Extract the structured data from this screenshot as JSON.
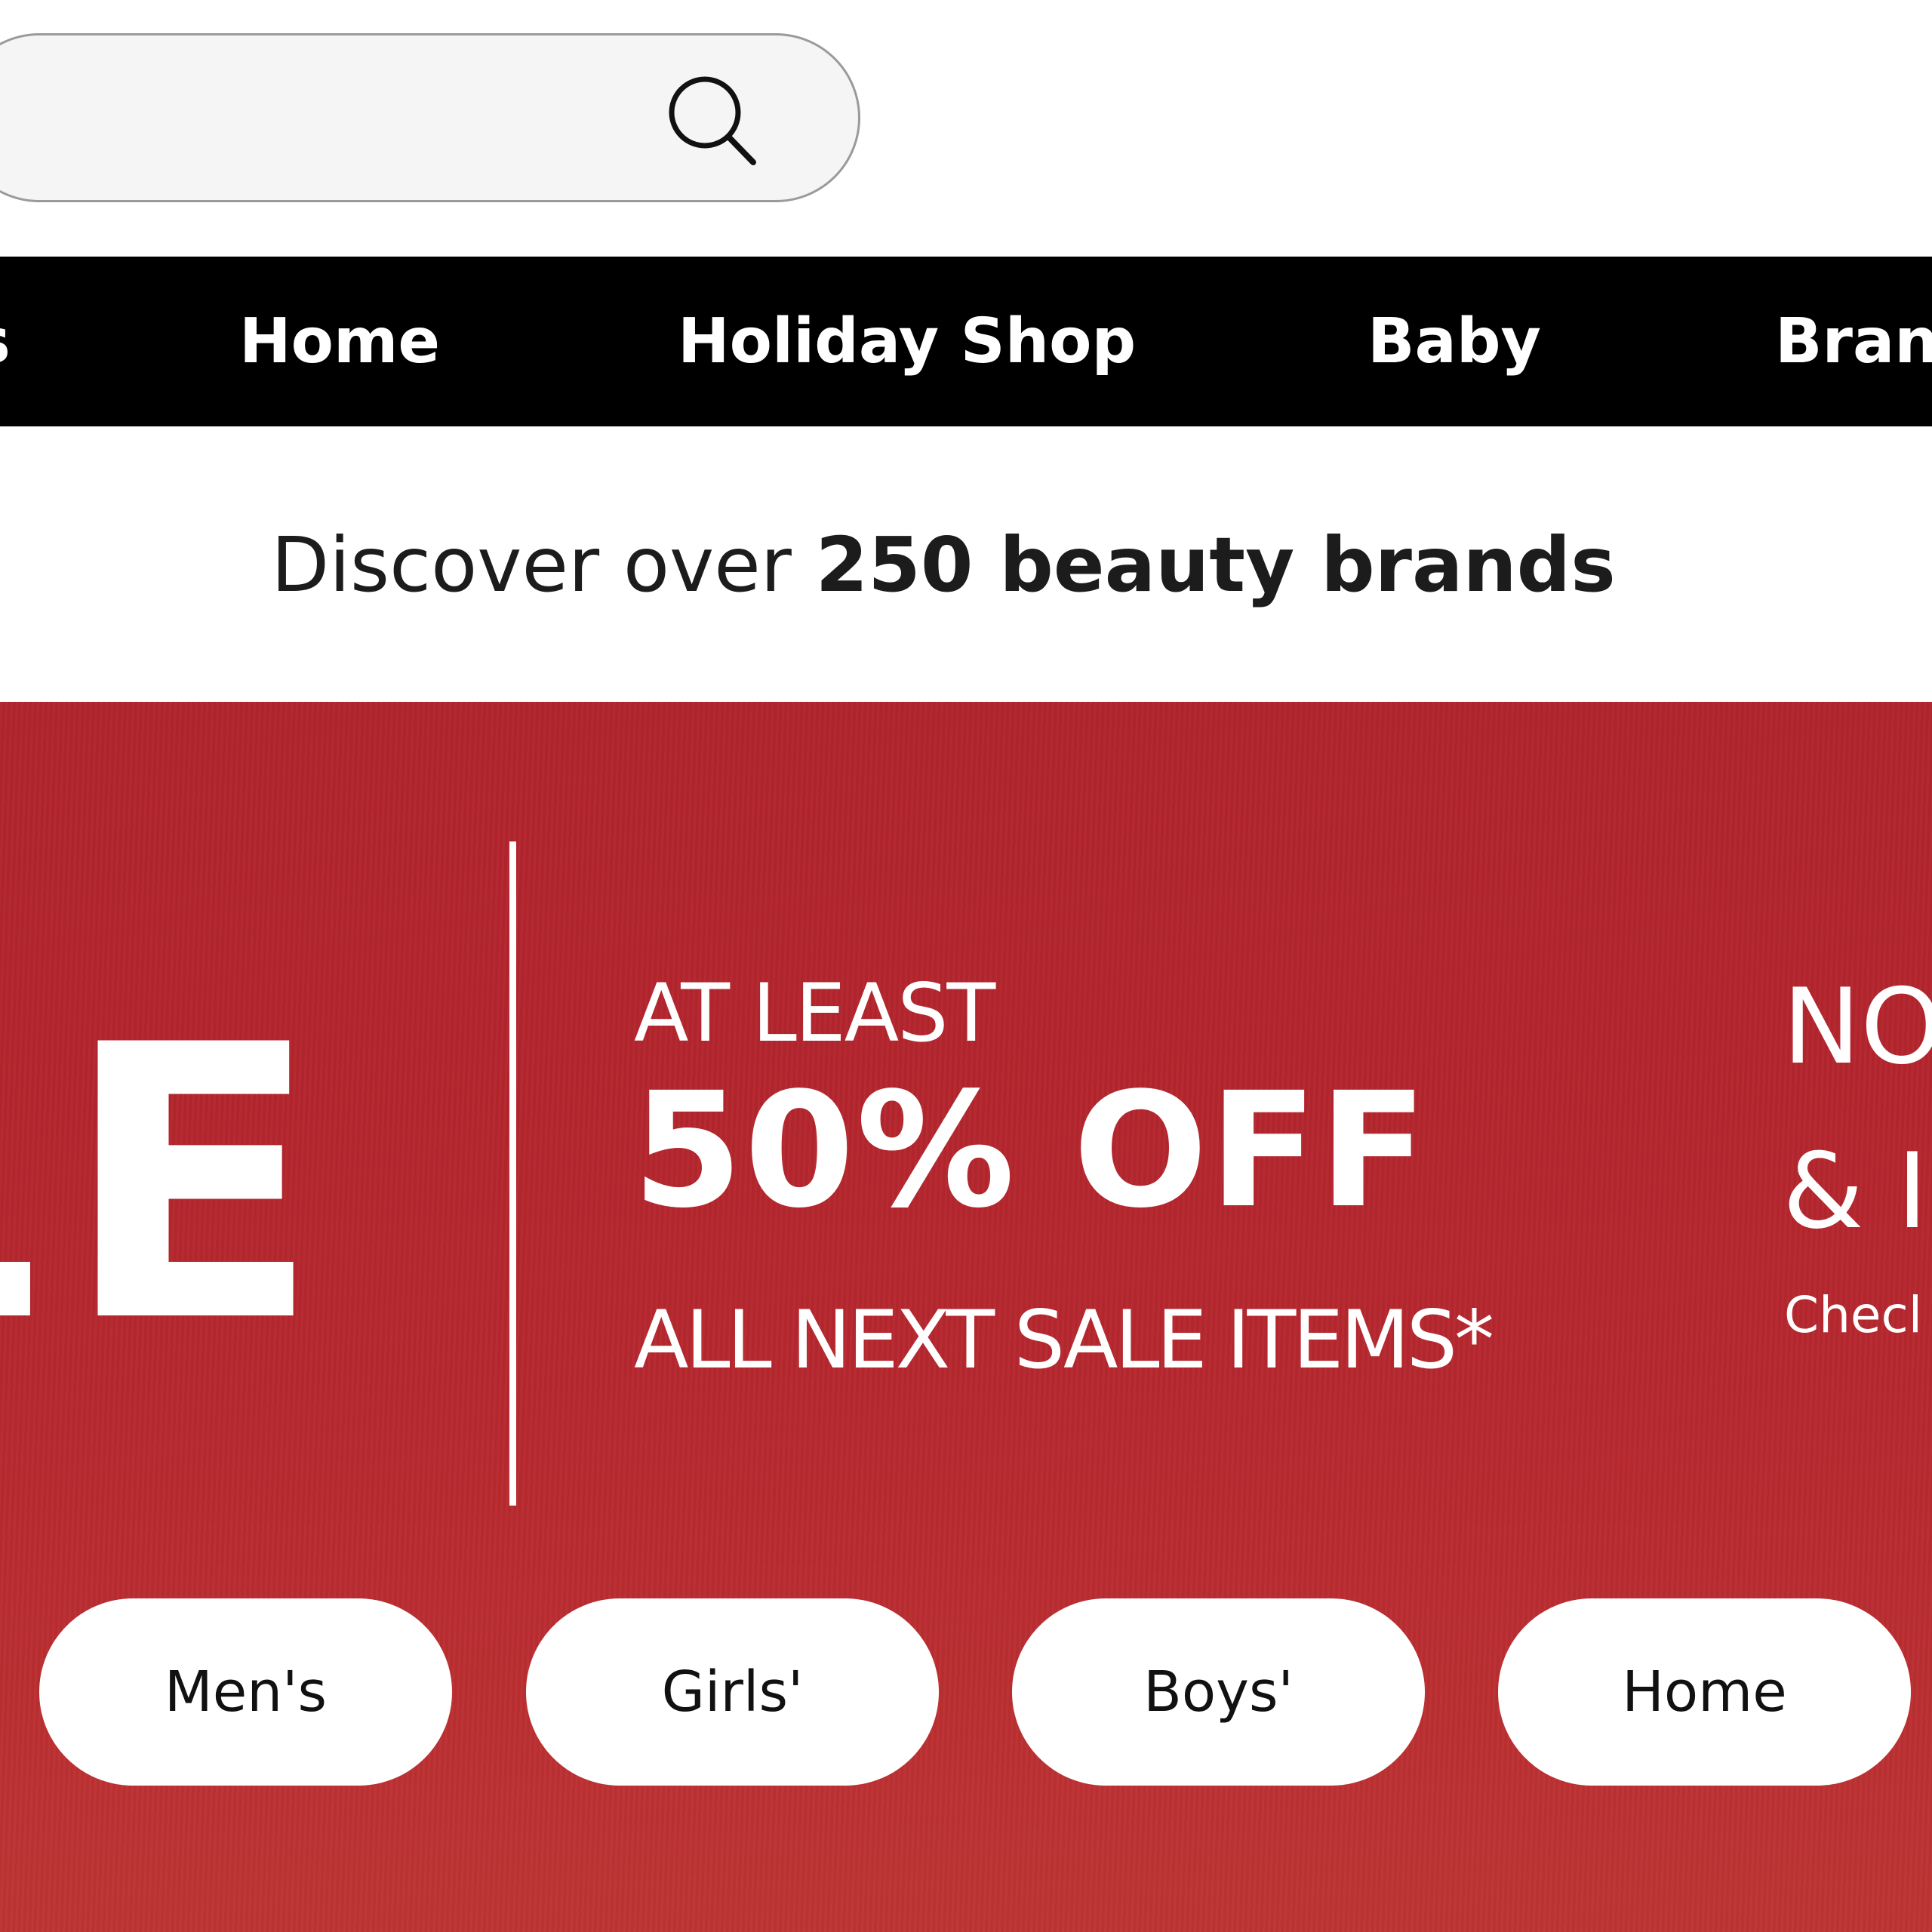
{
  "search": {
    "value": "",
    "placeholder": ""
  },
  "nav": {
    "items": [
      {
        "label": "s"
      },
      {
        "label": "Home"
      },
      {
        "label": "Holiday Shop"
      },
      {
        "label": "Baby"
      },
      {
        "label": "Bran"
      }
    ]
  },
  "promo": {
    "prefix": "Discover over ",
    "highlight": "250 beauty brands"
  },
  "hero": {
    "sale_word": "LE",
    "at_least": "AT LEAST",
    "discount": "50% OFF",
    "items": "ALL NEXT SALE ITEMS*",
    "right_line1": "NO",
    "right_line2": "& I",
    "right_line3": "Checl",
    "categories": [
      {
        "label": "Men's"
      },
      {
        "label": "Girls'"
      },
      {
        "label": "Boys'"
      },
      {
        "label": "Home"
      }
    ]
  },
  "colors": {
    "nav_bg": "#000000",
    "hero_bg": "#b4262e",
    "pill_bg": "#ffffff",
    "search_bg": "#f5f5f5"
  },
  "icons": {
    "search": "search-icon"
  }
}
